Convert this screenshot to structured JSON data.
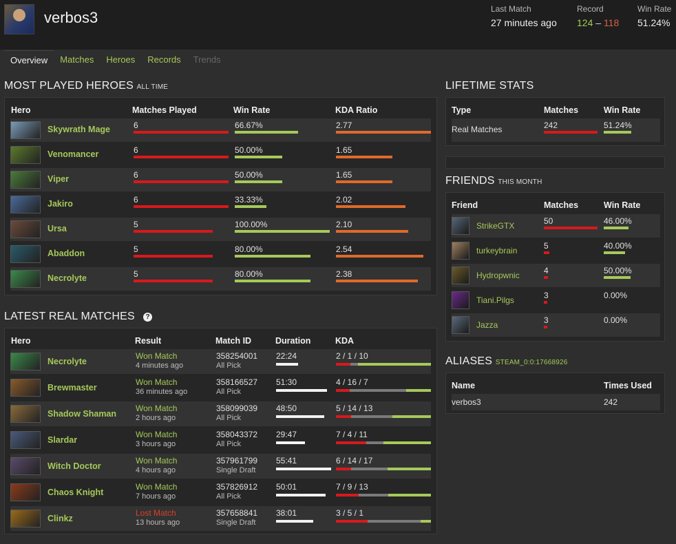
{
  "player": {
    "name": "verbos3"
  },
  "header_stats": {
    "last_match_label": "Last Match",
    "last_match_value": "27 minutes ago",
    "record_label": "Record",
    "record_wins": "124",
    "record_sep": "–",
    "record_losses": "118",
    "winrate_label": "Win Rate",
    "winrate_value": "51.24%"
  },
  "tabs": [
    "Overview",
    "Matches",
    "Heroes",
    "Records",
    "Trends"
  ],
  "most_played": {
    "title": "MOST PLAYED HEROES",
    "subtitle": "ALL TIME",
    "headers": [
      "Hero",
      "Matches Played",
      "Win Rate",
      "KDA Ratio"
    ],
    "rows": [
      {
        "hero": "Skywrath Mage",
        "matches": "6",
        "winrate": "66.67%",
        "kda": "2.77",
        "matches_frac": 1.0,
        "win_frac": 0.6667,
        "kda_frac": 1.0,
        "color": "#7a9cb8"
      },
      {
        "hero": "Venomancer",
        "matches": "6",
        "winrate": "50.00%",
        "kda": "1.65",
        "matches_frac": 1.0,
        "win_frac": 0.5,
        "kda_frac": 0.596,
        "color": "#5a7a2a"
      },
      {
        "hero": "Viper",
        "matches": "6",
        "winrate": "50.00%",
        "kda": "1.65",
        "matches_frac": 1.0,
        "win_frac": 0.5,
        "kda_frac": 0.596,
        "color": "#4a7a3a"
      },
      {
        "hero": "Jakiro",
        "matches": "6",
        "winrate": "33.33%",
        "kda": "2.02",
        "matches_frac": 1.0,
        "win_frac": 0.3333,
        "kda_frac": 0.729,
        "color": "#4a6a9a"
      },
      {
        "hero": "Ursa",
        "matches": "5",
        "winrate": "100.00%",
        "kda": "2.10",
        "matches_frac": 0.833,
        "win_frac": 1.0,
        "kda_frac": 0.758,
        "color": "#6a4a3a"
      },
      {
        "hero": "Abaddon",
        "matches": "5",
        "winrate": "80.00%",
        "kda": "2.54",
        "matches_frac": 0.833,
        "win_frac": 0.8,
        "kda_frac": 0.917,
        "color": "#2a5a6a"
      },
      {
        "hero": "Necrolyte",
        "matches": "5",
        "winrate": "80.00%",
        "kda": "2.38",
        "matches_frac": 0.833,
        "win_frac": 0.8,
        "kda_frac": 0.859,
        "color": "#3a8a4a"
      }
    ]
  },
  "latest_matches": {
    "title": "LATEST REAL MATCHES",
    "headers": [
      "Hero",
      "Result",
      "Match ID",
      "Duration",
      "KDA"
    ],
    "rows": [
      {
        "hero": "Necrolyte",
        "result": "Won Match",
        "won": true,
        "ago": "4 minutes ago",
        "match_id": "358254001",
        "mode": "All Pick",
        "duration": "22:24",
        "dur_frac": 0.4,
        "kda": "2 / 1 / 10",
        "k": 2,
        "d": 1,
        "a": 10,
        "color": "#3a8a4a"
      },
      {
        "hero": "Brewmaster",
        "result": "Won Match",
        "won": true,
        "ago": "36 minutes ago",
        "match_id": "358166527",
        "mode": "All Pick",
        "duration": "51:30",
        "dur_frac": 0.92,
        "kda": "4 / 16 / 7",
        "k": 4,
        "d": 16,
        "a": 7,
        "color": "#8a5a2a"
      },
      {
        "hero": "Shadow Shaman",
        "result": "Won Match",
        "won": true,
        "ago": "2 hours ago",
        "match_id": "358099039",
        "mode": "All Pick",
        "duration": "48:50",
        "dur_frac": 0.87,
        "kda": "5 / 14 / 13",
        "k": 5,
        "d": 14,
        "a": 13,
        "color": "#8a6a3a"
      },
      {
        "hero": "Slardar",
        "result": "Won Match",
        "won": true,
        "ago": "3 hours ago",
        "match_id": "358043372",
        "mode": "All Pick",
        "duration": "29:47",
        "dur_frac": 0.53,
        "kda": "7 / 4 / 11",
        "k": 7,
        "d": 4,
        "a": 11,
        "color": "#4a5a7a"
      },
      {
        "hero": "Witch Doctor",
        "result": "Won Match",
        "won": true,
        "ago": "4 hours ago",
        "match_id": "357961799",
        "mode": "Single Draft",
        "duration": "55:41",
        "dur_frac": 1.0,
        "kda": "6 / 14 / 17",
        "k": 6,
        "d": 14,
        "a": 17,
        "color": "#5a4a6a"
      },
      {
        "hero": "Chaos Knight",
        "result": "Won Match",
        "won": true,
        "ago": "7 hours ago",
        "match_id": "357826912",
        "mode": "All Pick",
        "duration": "50:01",
        "dur_frac": 0.9,
        "kda": "7 / 9 / 13",
        "k": 7,
        "d": 9,
        "a": 13,
        "color": "#8a3a1a"
      },
      {
        "hero": "Clinkz",
        "result": "Lost Match",
        "won": false,
        "ago": "13 hours ago",
        "match_id": "357658841",
        "mode": "Single Draft",
        "duration": "38:01",
        "dur_frac": 0.68,
        "kda": "3 / 5 / 1",
        "k": 3,
        "d": 5,
        "a": 1,
        "color": "#9a6a1a"
      }
    ]
  },
  "lifetime": {
    "title": "LIFETIME STATS",
    "headers": [
      "Type",
      "Matches",
      "Win Rate"
    ],
    "rows": [
      {
        "type": "Real Matches",
        "matches": "242",
        "winrate": "51.24%",
        "win_frac": 0.5124
      }
    ]
  },
  "friends": {
    "title": "FRIENDS",
    "subtitle": "THIS MONTH",
    "headers": [
      "Friend",
      "Matches",
      "Win Rate"
    ],
    "rows": [
      {
        "name": "StrikeGTX",
        "matches": "50",
        "winrate": "46.00%",
        "m_frac": 1.0,
        "w_frac": 0.46,
        "color": "#556677"
      },
      {
        "name": "turkeybrain",
        "matches": "5",
        "winrate": "40.00%",
        "m_frac": 0.1,
        "w_frac": 0.4,
        "color": "#a08060"
      },
      {
        "name": "Hydropwnic",
        "matches": "4",
        "winrate": "50.00%",
        "m_frac": 0.08,
        "w_frac": 0.5,
        "color": "#6a5a2a"
      },
      {
        "name": "Tiani.Pilgs",
        "matches": "3",
        "winrate": "0.00%",
        "m_frac": 0.06,
        "w_frac": 0.0,
        "color": "#6a2a8a"
      },
      {
        "name": "Jazza",
        "matches": "3",
        "winrate": "0.00%",
        "m_frac": 0.06,
        "w_frac": 0.0,
        "color": "#5a6a7a"
      }
    ]
  },
  "aliases": {
    "title": "ALIASES",
    "steam_id": "STEAM_0:0:17668926",
    "headers": [
      "Name",
      "Times Used"
    ],
    "rows": [
      {
        "name": "verbos3",
        "times": "242"
      }
    ]
  },
  "icons": {
    "help": "help-circle-icon"
  }
}
